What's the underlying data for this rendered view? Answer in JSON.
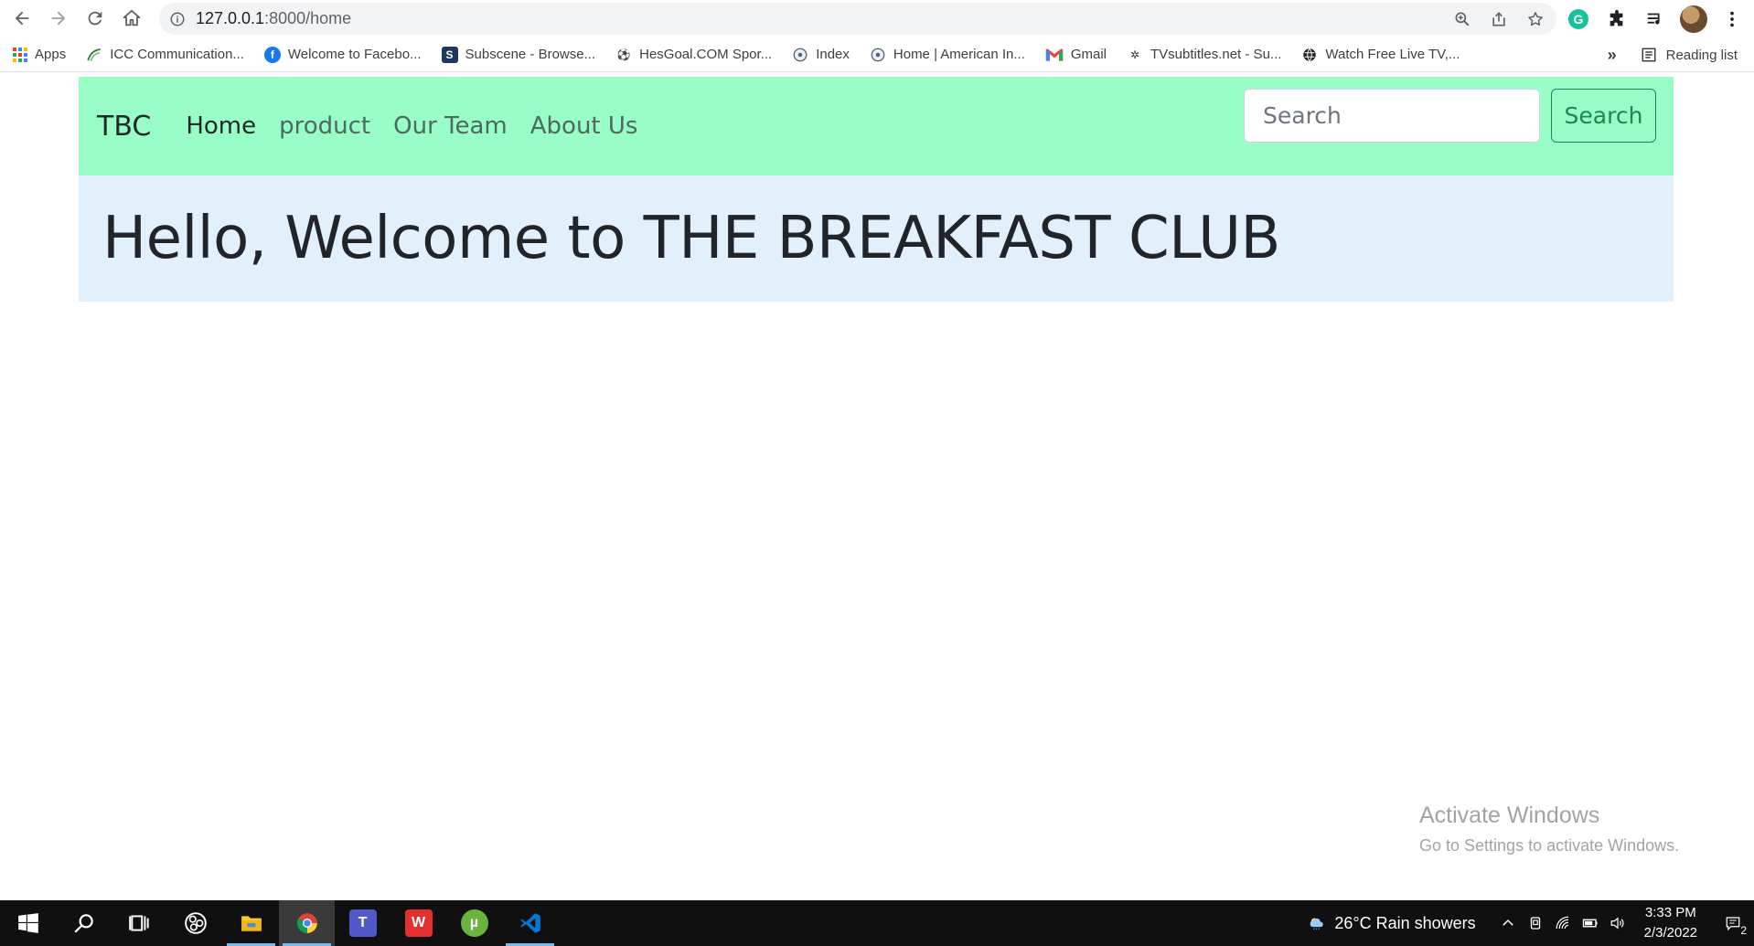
{
  "browser": {
    "url_host": "127.0.0.1",
    "url_path": ":8000/home"
  },
  "bookmarks": [
    {
      "label": "Apps",
      "icon": "apps-grid-icon"
    },
    {
      "label": "ICC Communication...",
      "icon": "icc-icon"
    },
    {
      "label": "Welcome to Facebo...",
      "icon": "facebook-icon"
    },
    {
      "label": "Subscene - Browse...",
      "icon": "subscene-icon"
    },
    {
      "label": "HesGoal.COM Spor...",
      "icon": "soccer-ball-icon"
    },
    {
      "label": "Index",
      "icon": "globe-icon"
    },
    {
      "label": "Home | American In...",
      "icon": "globe-icon"
    },
    {
      "label": "Gmail",
      "icon": "gmail-icon"
    },
    {
      "label": "TVsubtitles.net - Su...",
      "icon": "tvsubtitles-icon"
    },
    {
      "label": "Watch Free Live TV,...",
      "icon": "globe-dark-icon"
    }
  ],
  "bookmarks_more": "»",
  "reading_list": "Reading list",
  "navbar": {
    "brand": "TBC",
    "links": [
      "Home",
      "product",
      "Our Team",
      "About Us"
    ],
    "search_placeholder": "Search",
    "search_button": "Search"
  },
  "hero": {
    "heading": "Hello, Welcome to THE BREAKFAST CLUB"
  },
  "watermark": {
    "title": "Activate Windows",
    "subtitle": "Go to Settings to activate Windows."
  },
  "taskbar": {
    "weather": "26°C  Rain showers",
    "time": "3:33 PM",
    "date": "2/3/2022",
    "notifications": "2"
  },
  "colors": {
    "navbar_bg": "#99fdc8",
    "hero_bg": "#e2f0fc",
    "search_button": "#198754"
  }
}
